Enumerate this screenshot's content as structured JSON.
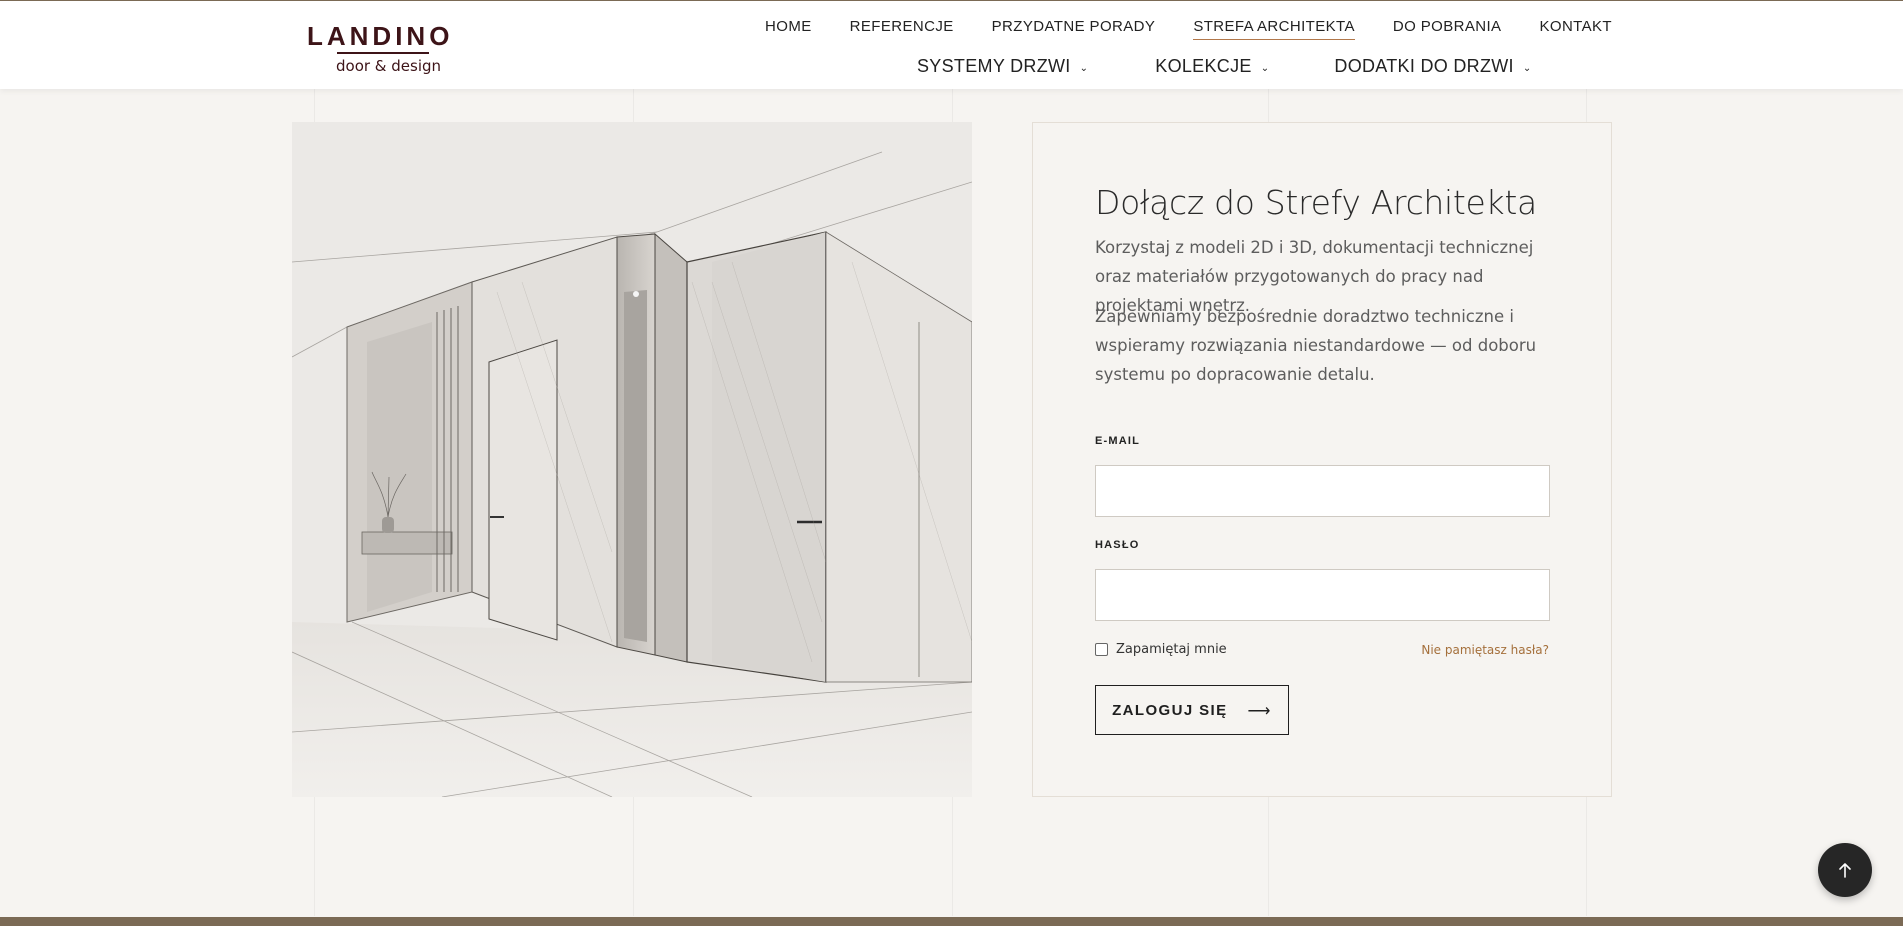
{
  "brand": {
    "name": "LANDINO",
    "tagline": "door & design",
    "color": "#3d1418"
  },
  "nav": {
    "top": [
      {
        "label": "HOME",
        "active": false
      },
      {
        "label": "REFERENCJE",
        "active": false
      },
      {
        "label": "PRZYDATNE PORADY",
        "active": false
      },
      {
        "label": "STREFA ARCHITEKTA",
        "active": true
      },
      {
        "label": "DO POBRANIA",
        "active": false
      },
      {
        "label": "KONTAKT",
        "active": false
      }
    ],
    "sub": [
      {
        "label": "SYSTEMY DRZWI",
        "icon": "chevron-down-icon"
      },
      {
        "label": "KOLEKCJE",
        "icon": "chevron-down-icon"
      },
      {
        "label": "DODATKI DO DRZWI",
        "icon": "chevron-down-icon"
      }
    ]
  },
  "login": {
    "title": "Dołącz do Strefy Architekta",
    "paragraph1": "Korzystaj z modeli 2D i 3D, dokumentacji technicznej oraz materiałów przygotowanych do pracy nad projektami wnętrz.",
    "paragraph2": "Zapewniamy bezpośrednie doradztwo techniczne i wspieramy rozwiązania niestandardowe — od doboru systemu po dopracowanie detalu.",
    "email_label": "E-MAIL",
    "email_value": "",
    "password_label": "HASŁO",
    "password_value": "",
    "remember_label": "Zapamiętaj mnie",
    "remember_checked": false,
    "forgot_label": "Nie pamiętasz hasła?",
    "submit_label": "ZALOGUJ SIĘ",
    "submit_icon": "arrow-right-icon"
  },
  "colors": {
    "accent": "#b2784b",
    "link": "#a5703c",
    "footer": "#7b6a55",
    "background": "#f6f4f1"
  },
  "scroll_top_icon": "arrow-up-icon"
}
